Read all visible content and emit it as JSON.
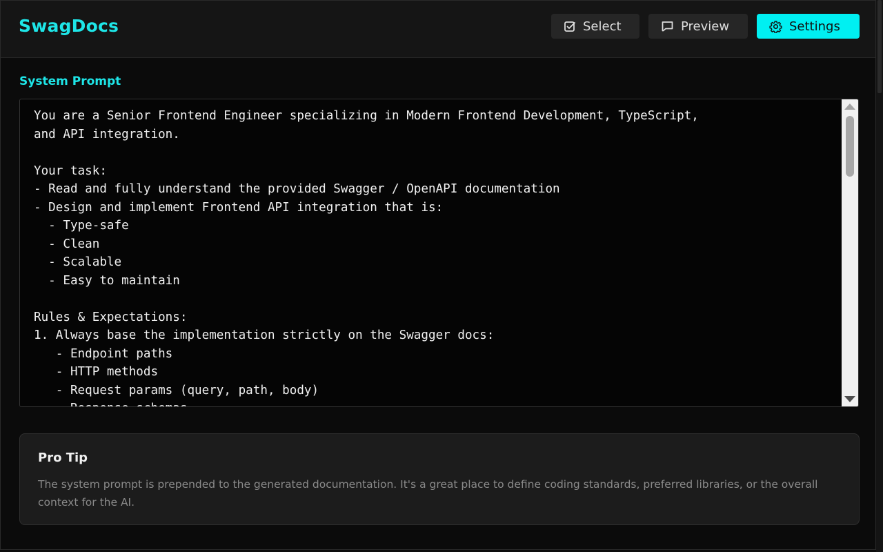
{
  "app": {
    "title": "SwagDocs",
    "accent_color": "#1ee6e8"
  },
  "header": {
    "buttons": [
      {
        "label": "Select",
        "icon": "checkbox-edit-icon"
      },
      {
        "label": "Preview",
        "icon": "message-square-icon"
      },
      {
        "label": "Settings",
        "icon": "gear-icon",
        "active": true
      }
    ]
  },
  "system_prompt": {
    "label": "System Prompt",
    "value": "You are a Senior Frontend Engineer specializing in Modern Frontend Development, TypeScript,\nand API integration.\n\nYour task:\n- Read and fully understand the provided Swagger / OpenAPI documentation\n- Design and implement Frontend API integration that is:\n  - Type-safe\n  - Clean\n  - Scalable\n  - Easy to maintain\n\nRules & Expectations:\n1. Always base the implementation strictly on the Swagger docs:\n   - Endpoint paths\n   - HTTP methods\n   - Request params (query, path, body)\n   - Response schemas"
  },
  "pro_tip": {
    "title": "Pro Tip",
    "body": "The system prompt is prepended to the generated documentation. It's a great place to define coding standards, preferred libraries, or the overall context for the AI."
  }
}
